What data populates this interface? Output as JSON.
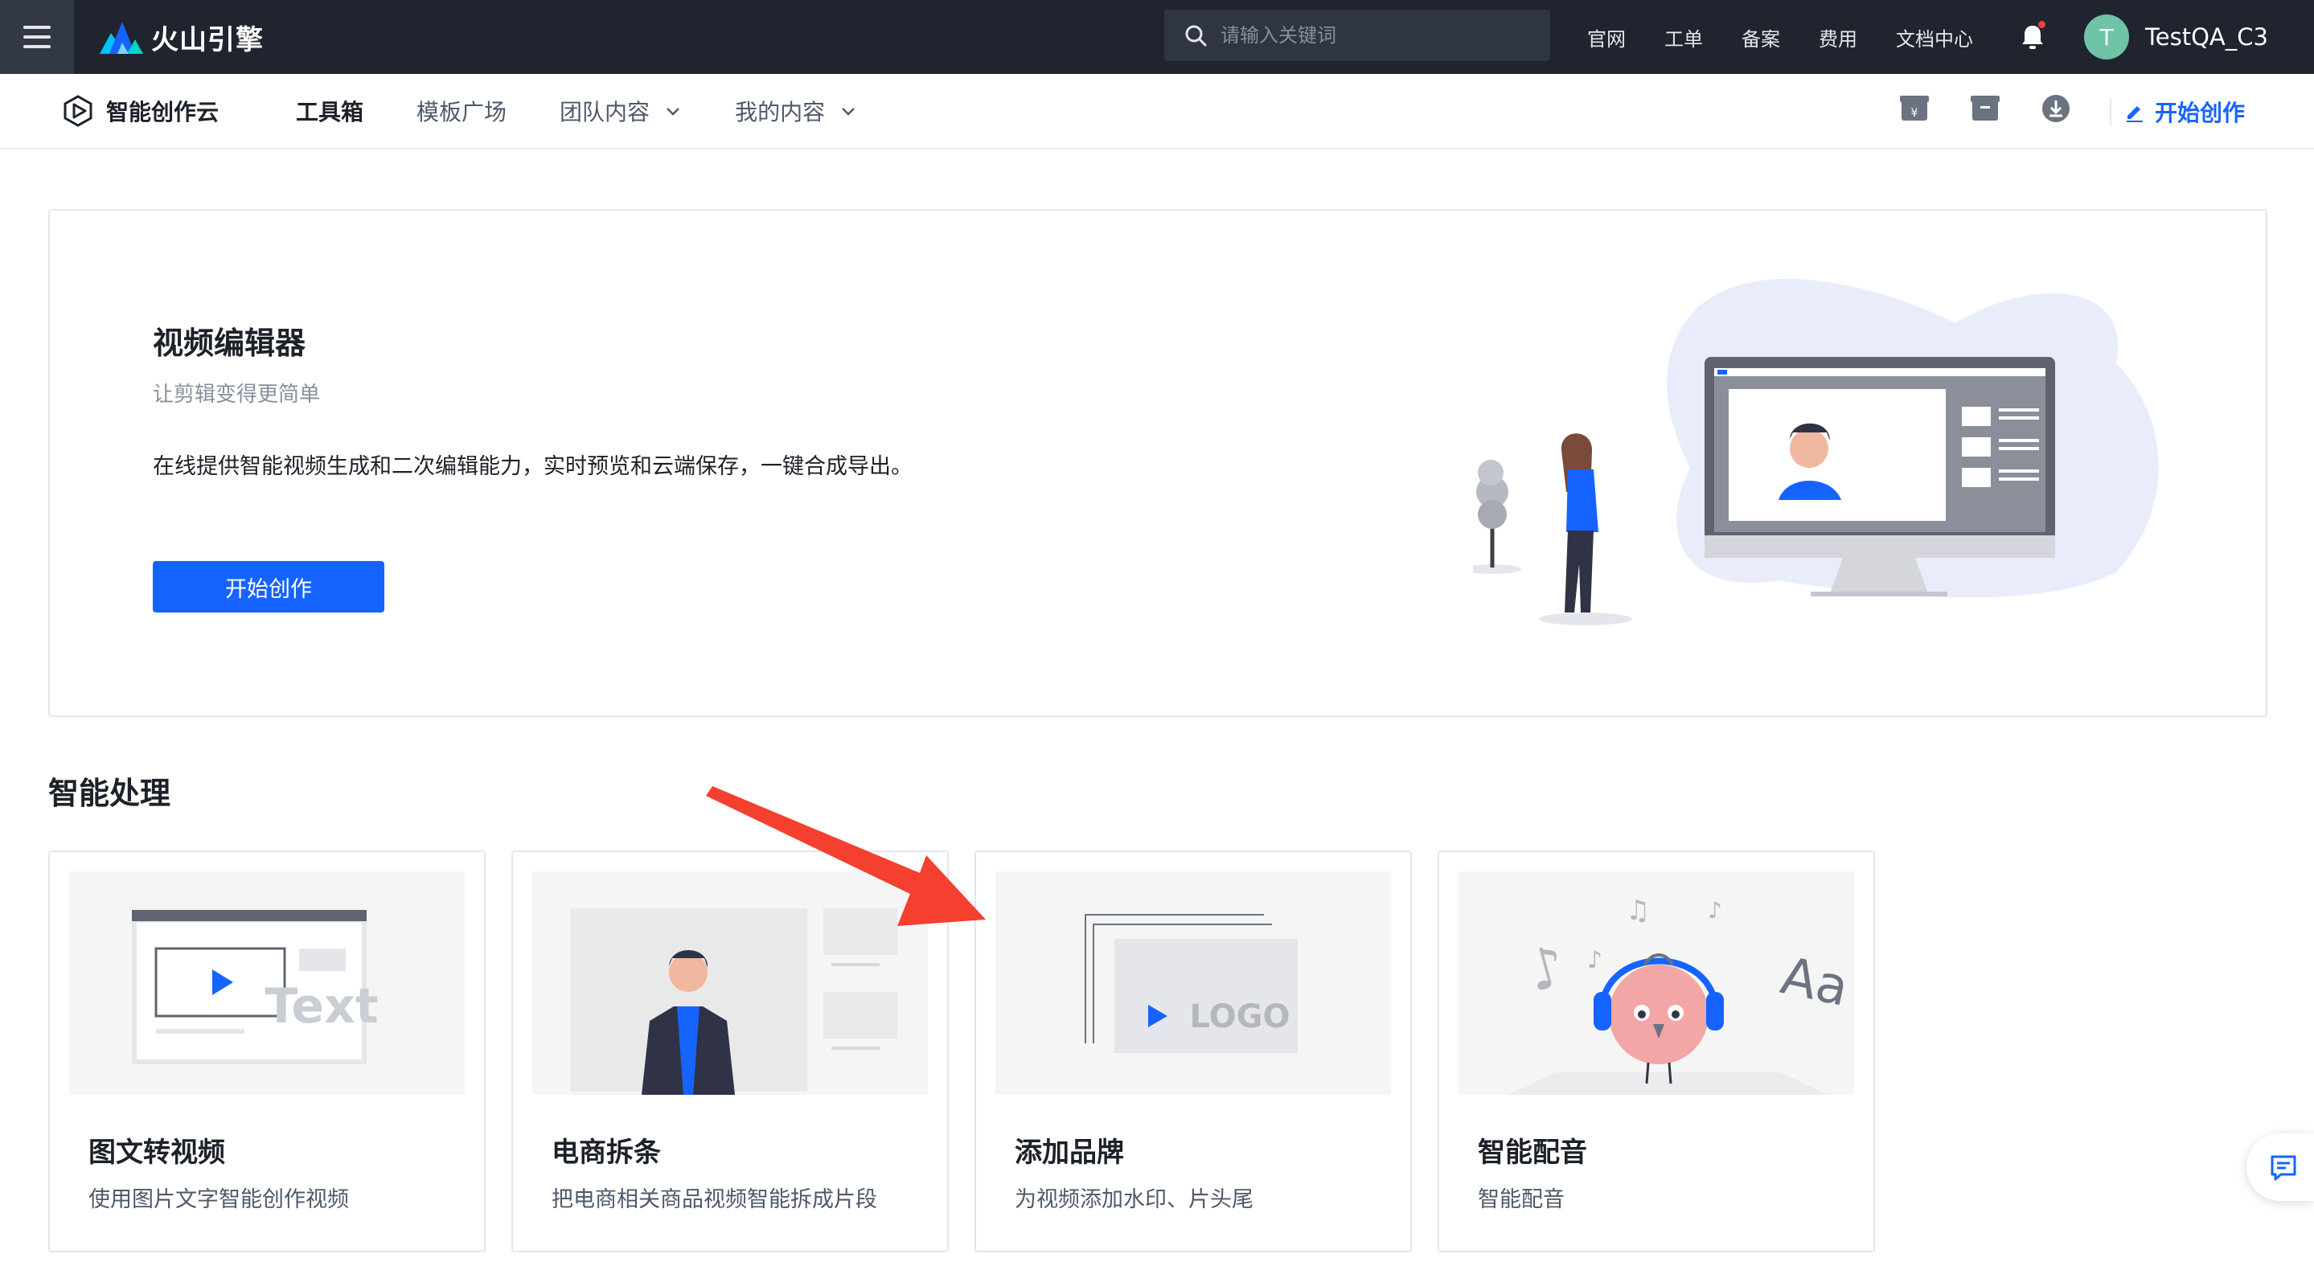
{
  "topbar": {
    "brand": "火山引擎",
    "search_placeholder": "请输入关键词",
    "links": [
      "官网",
      "工单",
      "备案",
      "费用",
      "文档中心"
    ],
    "avatar_letter": "T",
    "username": "TestQA_C3"
  },
  "subnav": {
    "product": "智能创作云",
    "tabs": [
      {
        "label": "工具箱",
        "active": true
      },
      {
        "label": "模板广场"
      },
      {
        "label": "团队内容"
      },
      {
        "label": "我的内容"
      }
    ],
    "start_label": "开始创作"
  },
  "hero": {
    "title": "视频编辑器",
    "subtitle": "让剪辑变得更简单",
    "description": "在线提供智能视频生成和二次编辑能力，实时预览和云端保存，一键合成导出。",
    "button": "开始创作"
  },
  "section": {
    "title": "智能处理",
    "cards": [
      {
        "title": "图文转视频",
        "desc": "使用图片文字智能创作视频",
        "thumb_text": "Text"
      },
      {
        "title": "电商拆条",
        "desc": "把电商相关商品视频智能拆成片段"
      },
      {
        "title": "添加品牌",
        "desc": "为视频添加水印、片头尾",
        "thumb_text": "LOGO"
      },
      {
        "title": "智能配音",
        "desc": "智能配音",
        "thumb_text": "Aa"
      }
    ]
  },
  "colors": {
    "topbar_bg": "#1f242e",
    "accent": "#1664ff",
    "arrow": "#f53f2f"
  }
}
